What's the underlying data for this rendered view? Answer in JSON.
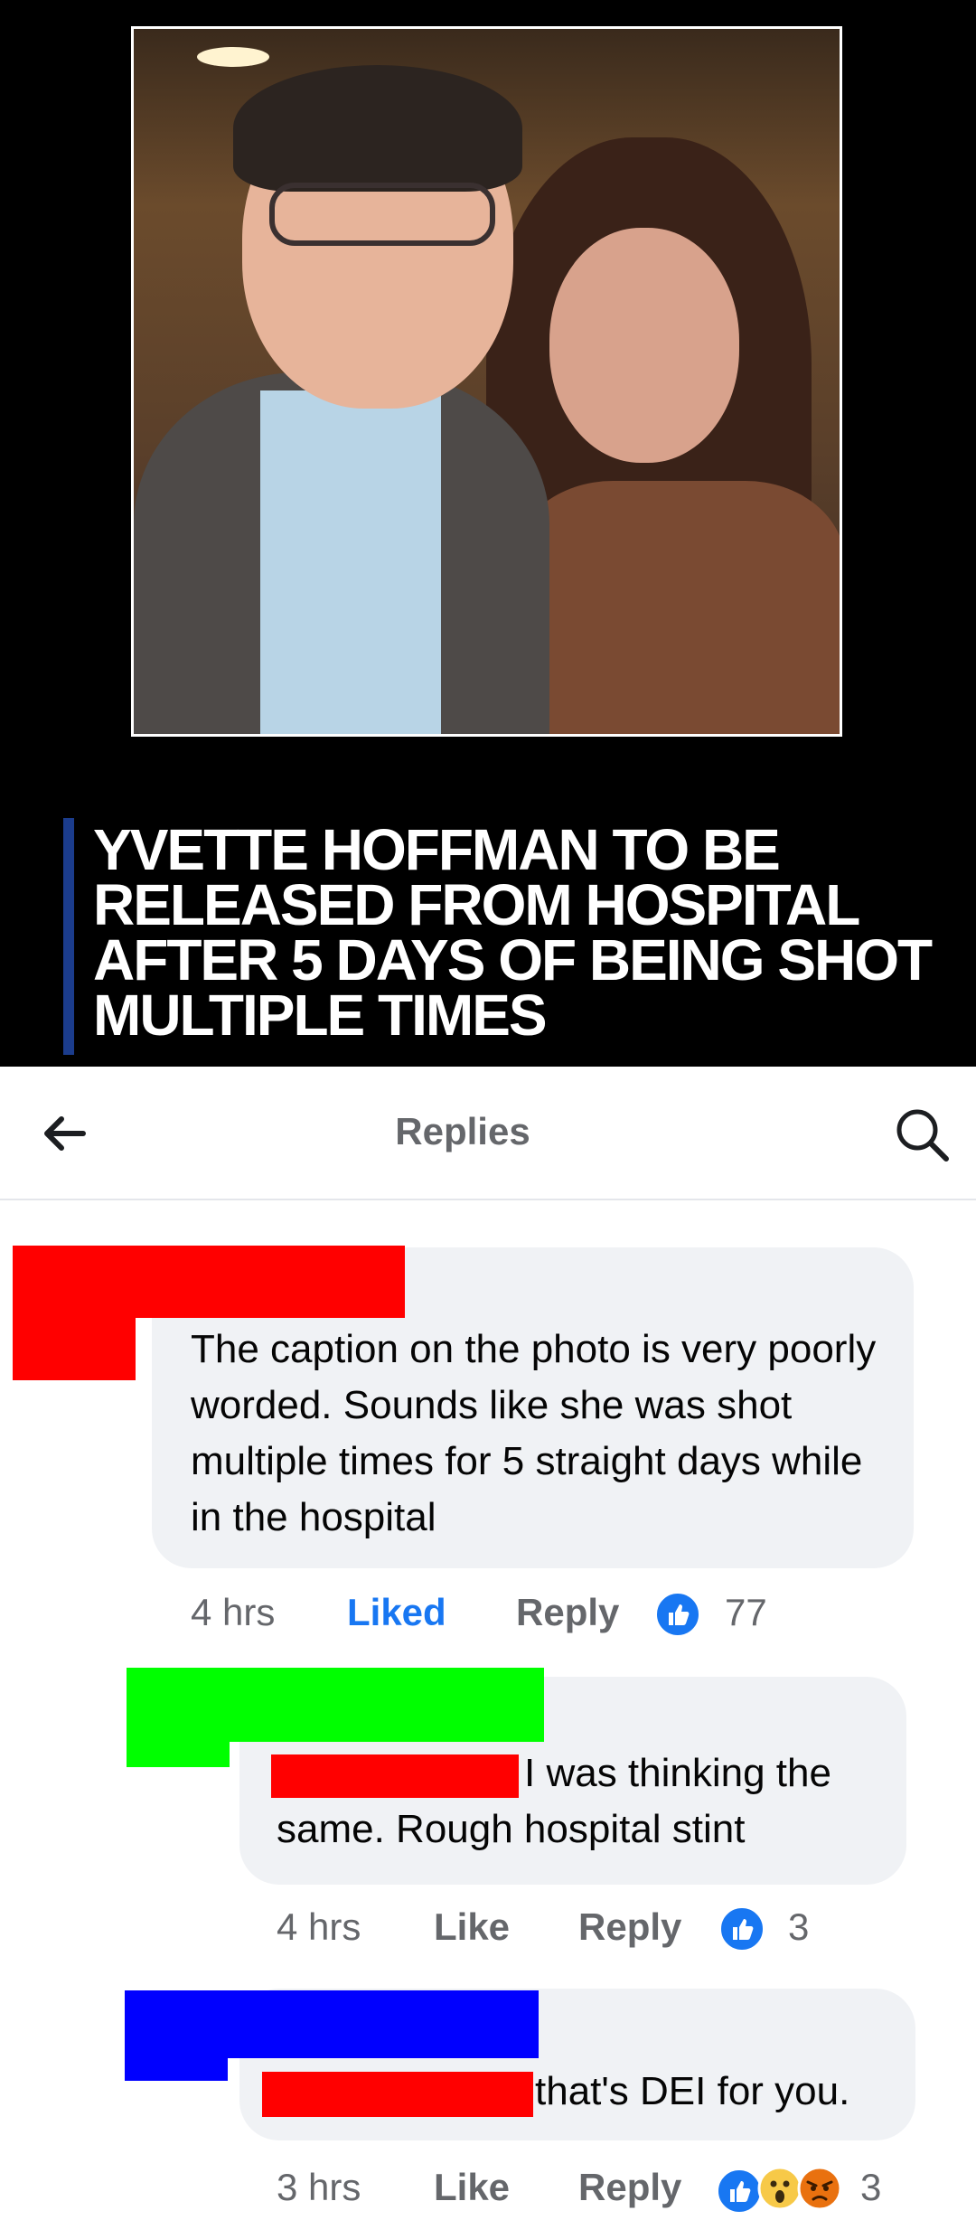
{
  "news": {
    "headline": "YVETTE HOFFMAN TO BE RELEASED FROM HOSPITAL AFTER 5 DAYS OF BEING SHOT MULTIPLE TIMES"
  },
  "header": {
    "back_icon": "arrow-left-icon",
    "title": "Replies",
    "search_icon": "search-icon"
  },
  "comments": [
    {
      "text": "The caption on the photo is very poorly worded. Sounds like she was shot multiple times for 5 straight days while in the hospital",
      "time": "4 hrs",
      "like_label": "Liked",
      "reply_label": "Reply",
      "reaction_count": "77",
      "redaction_color": "#ff0000"
    },
    {
      "text": "I was thinking the same. Rough hospital stint",
      "time": "4 hrs",
      "like_label": "Like",
      "reply_label": "Reply",
      "reaction_count": "3",
      "redaction_color": "#00ff00"
    },
    {
      "text": "that's DEI for you.",
      "time": "3 hrs",
      "like_label": "Like",
      "reply_label": "Reply",
      "reaction_count": "3",
      "redaction_color": "#0000ff"
    }
  ],
  "colors": {
    "liked": "#1877f2",
    "mention_redaction": "#ff0000"
  }
}
